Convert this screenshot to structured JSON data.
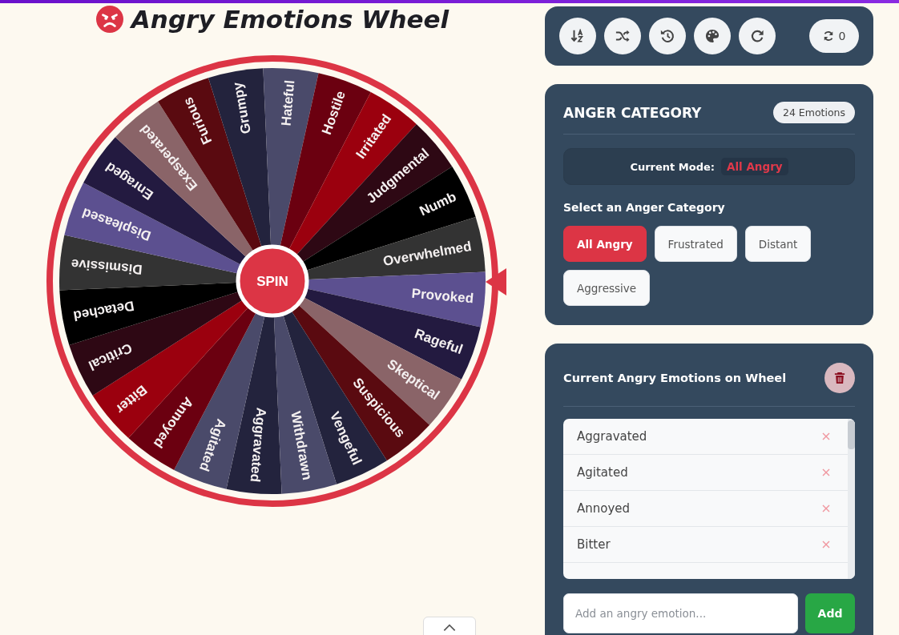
{
  "header": {
    "title": "Angry Emotions Wheel"
  },
  "wheel": {
    "spin_label": "SPIN",
    "segments": [
      {
        "label": "Aggravated",
        "color": "#23233d"
      },
      {
        "label": "Agitated",
        "color": "#4a4a6a"
      },
      {
        "label": "Annoyed",
        "color": "#6b0010"
      },
      {
        "label": "Bitter",
        "color": "#9b000e"
      },
      {
        "label": "Critical",
        "color": "#2e0814"
      },
      {
        "label": "Detached",
        "color": "#000000"
      },
      {
        "label": "Dismissive",
        "color": "#333333"
      },
      {
        "label": "Displeased",
        "color": "#5c5090"
      },
      {
        "label": "Enraged",
        "color": "#231a40"
      },
      {
        "label": "Exasperated",
        "color": "#8a6468"
      },
      {
        "label": "Furious",
        "color": "#5a0a10"
      },
      {
        "label": "Grumpy",
        "color": "#23233d"
      },
      {
        "label": "Hateful",
        "color": "#4a4a6a"
      },
      {
        "label": "Hostile",
        "color": "#6b0010"
      },
      {
        "label": "Irritated",
        "color": "#9b000e"
      },
      {
        "label": "Judgmental",
        "color": "#2e0814"
      },
      {
        "label": "Numb",
        "color": "#000000"
      },
      {
        "label": "Overwhelmed",
        "color": "#333333"
      },
      {
        "label": "Provoked",
        "color": "#5c5090"
      },
      {
        "label": "Rageful",
        "color": "#231a40"
      },
      {
        "label": "Skeptical",
        "color": "#8a6468"
      },
      {
        "label": "Suspicious",
        "color": "#5a0a10"
      },
      {
        "label": "Vengeful",
        "color": "#23233d"
      },
      {
        "label": "Withdrawn",
        "color": "#4a4a6a"
      }
    ]
  },
  "toolbar": {
    "spin_count": "0"
  },
  "category_panel": {
    "title": "ANGER CATEGORY",
    "count_badge": "24 Emotions",
    "mode_label": "Current Mode:",
    "mode_value": "All Angry",
    "prompt": "Select an Anger Category",
    "options": [
      {
        "label": "All Angry",
        "selected": true
      },
      {
        "label": "Frustrated",
        "selected": false
      },
      {
        "label": "Distant",
        "selected": false
      },
      {
        "label": "Aggressive",
        "selected": false
      }
    ]
  },
  "emotions_panel": {
    "title": "Current Angry Emotions on Wheel",
    "items": [
      "Aggravated",
      "Agitated",
      "Annoyed",
      "Bitter"
    ],
    "input": {
      "placeholder": "Add an angry emotion..."
    },
    "add_button": "Add"
  }
}
